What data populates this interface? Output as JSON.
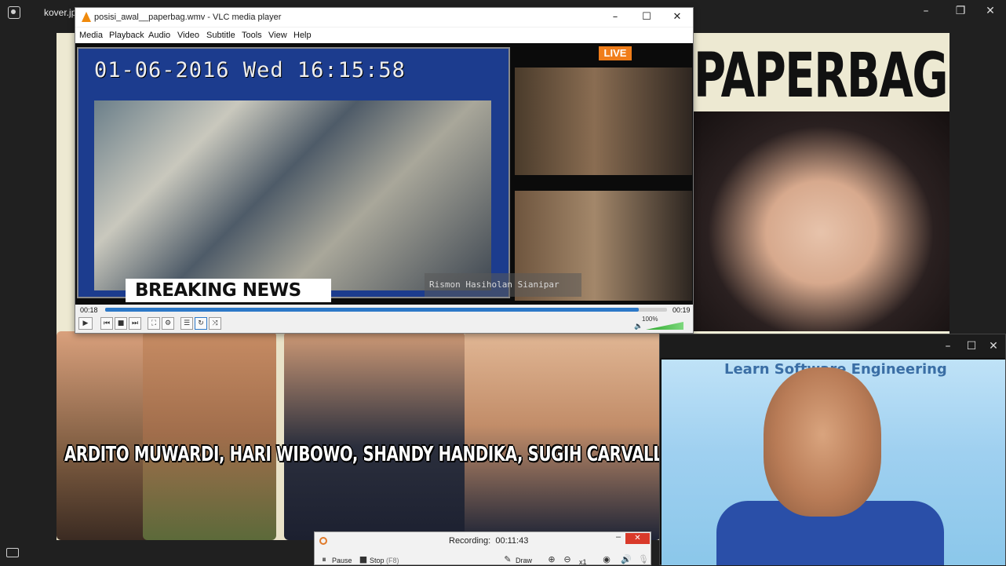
{
  "viewer": {
    "file_name": "kover.jpeg",
    "image_title": "PAPERBAG",
    "collage_caption": "ARDITO MUWARDI, HARI WIBOWO, SHANDY HANDIKA, SUGIH CARVALLO, MAYLA",
    "win_minimize": "–",
    "win_restore": "❐",
    "win_close": "✕"
  },
  "vlc": {
    "title": "posisi_awal__paperbag.wmv - VLC media player",
    "menu": [
      "Media",
      "Playback",
      "Audio",
      "Video",
      "Subtitle",
      "Tools",
      "View",
      "Help"
    ],
    "video": {
      "cctv_timestamp": "01-06-2016 Wed 16:15:58",
      "live_badge": "LIVE",
      "breaking_prefix": "BREAKING",
      "breaking_suffix": "NEWS",
      "watermark": "Rismon Hasiholan Sianipar"
    },
    "elapsed": "00:18",
    "total": "00:19",
    "progress_fraction": 0.95,
    "volume_label": "100%",
    "controls": {
      "play": "▶",
      "prev": "⏮",
      "stop": "■",
      "next": "⏭",
      "fullscreen": "⛶",
      "extended": "⚙",
      "playlist": "☰",
      "loop": "↻",
      "shuffle": "⤨"
    },
    "win_minimize": "–",
    "win_maximize": "☐",
    "win_close": "✕"
  },
  "webcam": {
    "banner_text": "Learn Software Engineering",
    "win_minimize": "–",
    "win_maximize": "☐",
    "win_close": "✕"
  },
  "recorder": {
    "status_label": "Recording:",
    "elapsed": "00:11:43",
    "pause_label": "Pause",
    "stop_label": "Stop",
    "stop_shortcut": "(F8)",
    "draw_label": "Draw",
    "zoom_level": "x1",
    "close": "✕",
    "minimize": "–"
  }
}
